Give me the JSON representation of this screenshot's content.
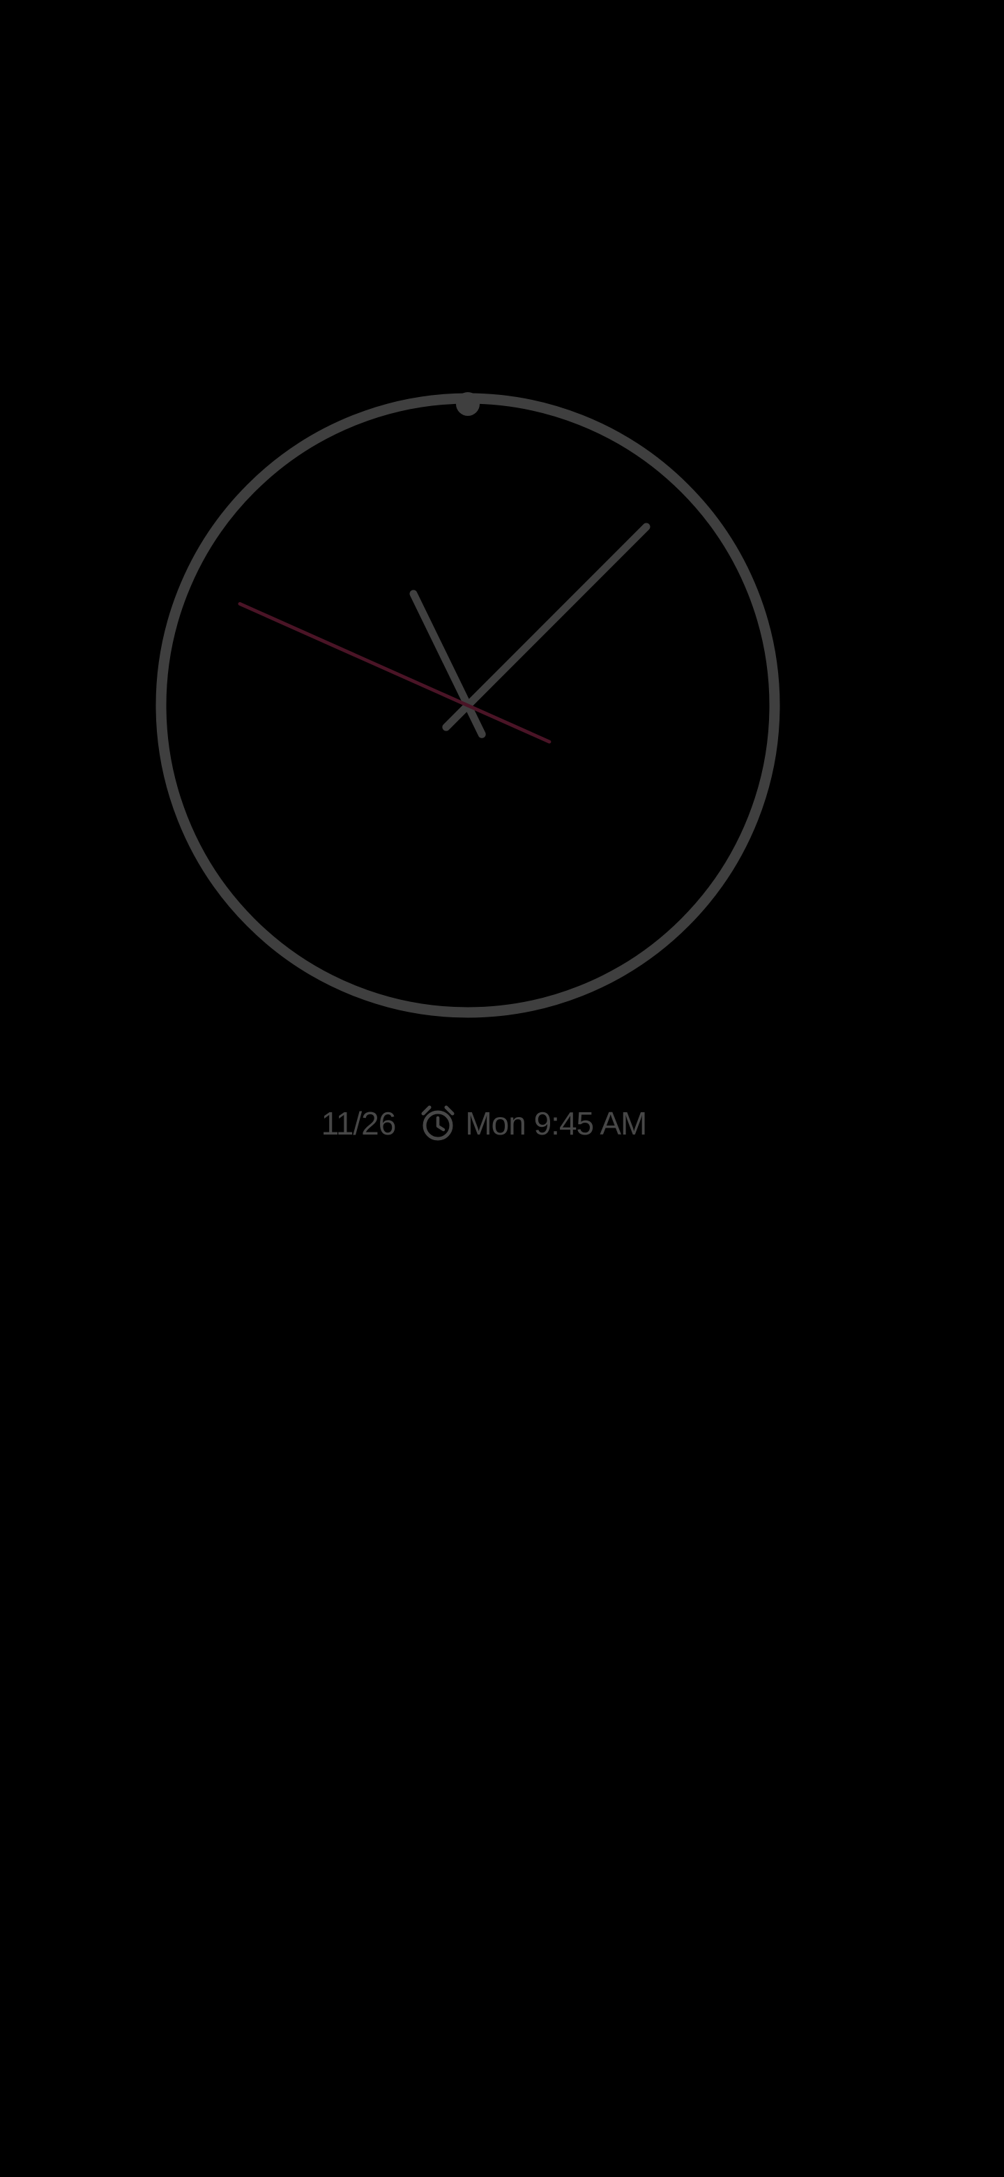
{
  "screen": {
    "type": "always-on-display",
    "background_color": "#000000"
  },
  "clock": {
    "style": "analog",
    "ring_color": "#3f3f3f",
    "hand_color": "#3f3f3f",
    "second_hand_color": "#4a1426",
    "hour_hand_angle_deg": 334,
    "minute_hand_angle_deg": 45,
    "second_hand_angle_deg": 294
  },
  "info": {
    "date": "11/26",
    "alarm_icon": "alarm-clock-icon",
    "alarm_text": "Mon 9:45 AM",
    "text_color": "#474747"
  }
}
